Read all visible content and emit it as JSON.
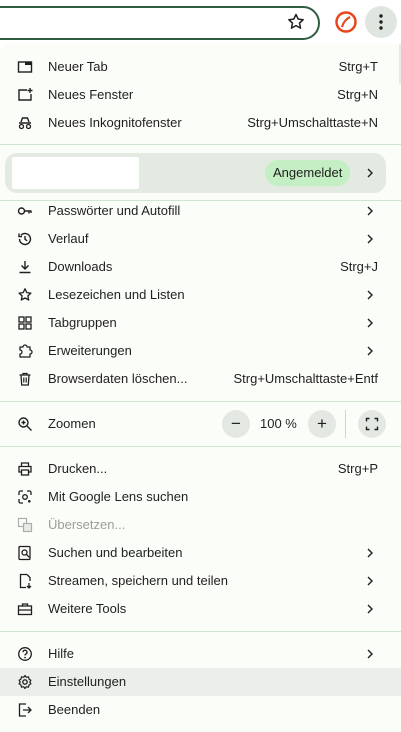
{
  "menu": {
    "group1": [
      {
        "label": "Neuer Tab",
        "shortcut": "Strg+T",
        "icon": "new-tab-icon"
      },
      {
        "label": "Neues Fenster",
        "shortcut": "Strg+N",
        "icon": "new-window-icon"
      },
      {
        "label": "Neues Inkognitofenster",
        "shortcut": "Strg+Umschalttaste+N",
        "icon": "incognito-icon"
      }
    ],
    "profile": {
      "badge": "Angemeldet"
    },
    "group2": [
      {
        "label": "Passwörter und Autofill",
        "icon": "key-icon",
        "submenu": true
      },
      {
        "label": "Verlauf",
        "icon": "history-icon",
        "submenu": true
      },
      {
        "label": "Downloads",
        "shortcut": "Strg+J",
        "icon": "download-icon"
      },
      {
        "label": "Lesezeichen und Listen",
        "icon": "star-icon",
        "submenu": true
      },
      {
        "label": "Tabgruppen",
        "icon": "tab-groups-icon",
        "submenu": true
      },
      {
        "label": "Erweiterungen",
        "icon": "extension-icon",
        "submenu": true
      },
      {
        "label": "Browserdaten löschen...",
        "shortcut": "Strg+Umschalttaste+Entf",
        "icon": "trash-icon"
      }
    ],
    "zoom": {
      "label": "Zoomen",
      "minus": "−",
      "value": "100 %",
      "plus": "+"
    },
    "group3": [
      {
        "label": "Drucken...",
        "shortcut": "Strg+P",
        "icon": "print-icon"
      },
      {
        "label": "Mit Google Lens suchen",
        "icon": "lens-icon"
      },
      {
        "label": "Übersetzen...",
        "icon": "translate-icon",
        "disabled": true
      },
      {
        "label": "Suchen und bearbeiten",
        "icon": "find-icon",
        "submenu": true
      },
      {
        "label": "Streamen, speichern und teilen",
        "icon": "cast-save-icon",
        "submenu": true
      },
      {
        "label": "Weitere Tools",
        "icon": "toolbox-icon",
        "submenu": true
      }
    ],
    "group4": [
      {
        "label": "Hilfe",
        "icon": "help-icon",
        "submenu": true
      },
      {
        "label": "Einstellungen",
        "icon": "settings-icon",
        "highlighted": true
      },
      {
        "label": "Beenden",
        "icon": "exit-icon"
      }
    ]
  },
  "colors": {
    "accent": "#c4eec3",
    "separator": "#cfe5cf",
    "menu_bg": "#fbfdf9",
    "omnibox_border": "#2f5d3f"
  }
}
